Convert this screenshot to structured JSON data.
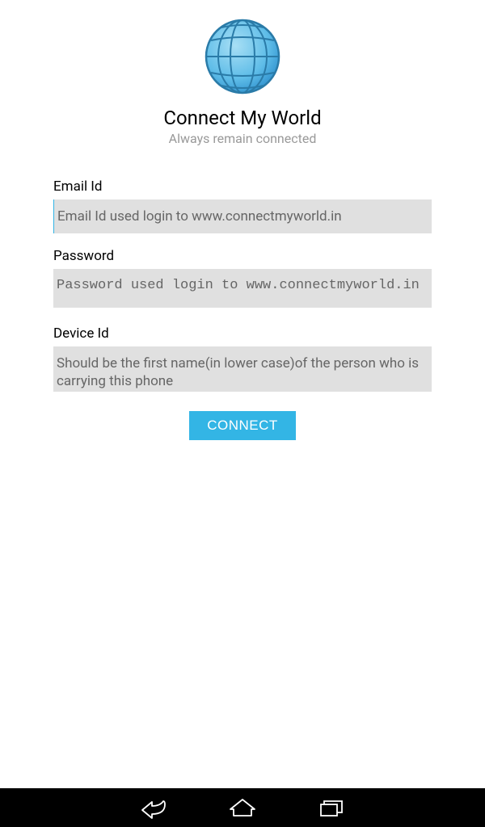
{
  "header": {
    "title": "Connect My World",
    "subtitle": "Always remain connected"
  },
  "form": {
    "email": {
      "label": "Email Id",
      "placeholder": "Email Id used login to www.connectmyworld.in"
    },
    "password": {
      "label": "Password",
      "placeholder": "Password used login to www.connectmyworld.in"
    },
    "device": {
      "label": "Device Id",
      "placeholder": "Should be the first name(in lower case)of the person who is carrying this phone"
    },
    "connect_button": "CONNECT"
  },
  "colors": {
    "accent": "#33b5e5",
    "input_bg": "#e0e0e0",
    "subtitle_text": "#999"
  }
}
